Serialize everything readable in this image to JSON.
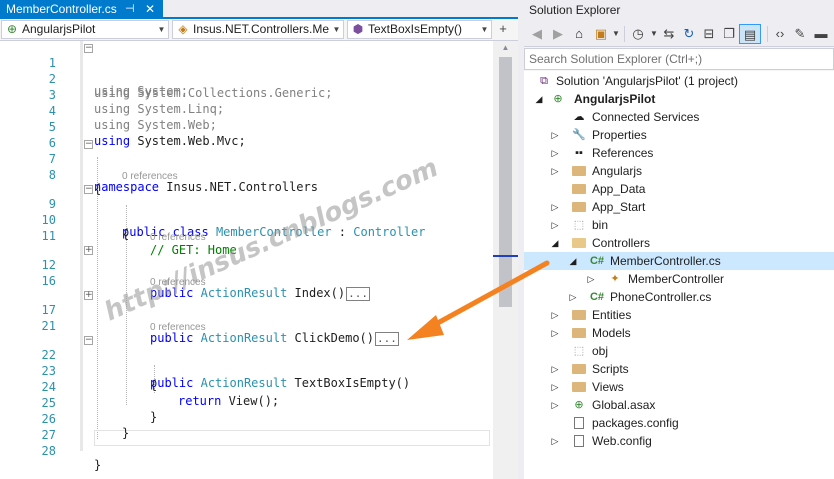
{
  "editor": {
    "tab": {
      "title": "MemberController.cs",
      "pin_icon": "pin-icon",
      "close_icon": "close-icon"
    },
    "nav": {
      "project": "AngularjsPilot",
      "type": "Insus.NET.Controllers.Me",
      "member": "TextBoxIsEmpty()"
    },
    "references_label": "0 references",
    "code": {
      "l1": [
        "using",
        " System;"
      ],
      "l2": [
        "using",
        " System.Collections.Generic;"
      ],
      "l3": [
        "using",
        " System.Linq;"
      ],
      "l4": [
        "using",
        " System.Web;"
      ],
      "l5": [
        "using",
        " System.Web.Mvc;"
      ],
      "l7": [
        "namespace",
        " Insus.NET.Controllers"
      ],
      "l8": "{",
      "l9": [
        "public",
        "class",
        "MemberController",
        ":",
        "Controller"
      ],
      "l10": "{",
      "l11": "// GET: Home",
      "l12": [
        "public",
        "ActionResult",
        "Index()",
        "..."
      ],
      "l17": [
        "public",
        "ActionResult",
        "ClickDemo()",
        "..."
      ],
      "l22": [
        "public",
        "ActionResult",
        "TextBoxIsEmpty()"
      ],
      "l23": "{",
      "l24": [
        "return",
        " View();"
      ],
      "l25": "}",
      "l26": "}",
      "l28": "}"
    },
    "line_numbers": [
      "1",
      "2",
      "3",
      "4",
      "5",
      "6",
      "7",
      "8",
      "9",
      "10",
      "11",
      "12",
      "16",
      "17",
      "21",
      "22",
      "23",
      "24",
      "25",
      "26",
      "27",
      "28"
    ]
  },
  "solution_explorer": {
    "title": "Solution Explorer",
    "search_placeholder": "Search Solution Explorer (Ctrl+;)",
    "tree": [
      {
        "label": "Solution 'AngularjsPilot' (1 project)"
      },
      {
        "label": "AngularjsPilot"
      },
      {
        "label": "Connected Services"
      },
      {
        "label": "Properties"
      },
      {
        "label": "References"
      },
      {
        "label": "Angularjs"
      },
      {
        "label": "App_Data"
      },
      {
        "label": "App_Start"
      },
      {
        "label": "bin"
      },
      {
        "label": "Controllers"
      },
      {
        "label": "MemberController.cs"
      },
      {
        "label": "MemberController"
      },
      {
        "label": "PhoneController.cs"
      },
      {
        "label": "Entities"
      },
      {
        "label": "Models"
      },
      {
        "label": "obj"
      },
      {
        "label": "Scripts"
      },
      {
        "label": "Views"
      },
      {
        "label": "Global.asax"
      },
      {
        "label": "packages.config"
      },
      {
        "label": "Web.config"
      }
    ]
  },
  "watermark": "http://insus.cnblogs.com",
  "colors": {
    "accent": "#007acc",
    "keyword": "#0000ff",
    "type": "#2b91af",
    "comment": "#008000",
    "arrow": "#f58220",
    "selection": "#cce8ff"
  }
}
